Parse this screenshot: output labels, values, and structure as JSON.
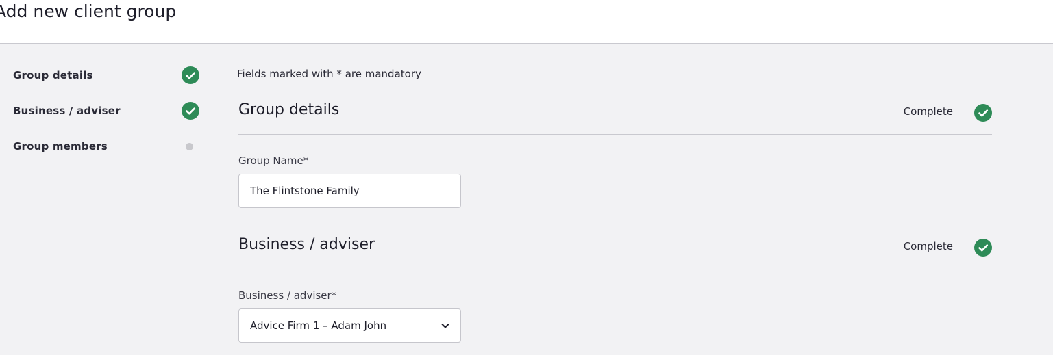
{
  "page": {
    "title": "Add new client group"
  },
  "sidebar": {
    "steps": [
      {
        "label": "Group details",
        "status": "complete",
        "icon": "check-circle-icon"
      },
      {
        "label": "Business / adviser",
        "status": "complete",
        "icon": "check-circle-icon"
      },
      {
        "label": "Group members",
        "status": "pending",
        "icon": "pending-dot-icon"
      }
    ]
  },
  "main": {
    "mandatory_note": "Fields marked with * are mandatory",
    "sections": [
      {
        "title": "Group details",
        "status": "Complete",
        "field": {
          "label": "Group Name*",
          "value": "The Flintstone Family"
        }
      },
      {
        "title": "Business / adviser",
        "status": "Complete",
        "field": {
          "label": "Business / adviser*",
          "value": "Advice Firm 1 – Adam John",
          "icon": "chevron-down-icon"
        }
      }
    ]
  },
  "colors": {
    "complete": "#2e8b57",
    "pending": "#c8c8cc",
    "panel_background": "#f2f2f4",
    "divider": "#c9c9cf"
  }
}
